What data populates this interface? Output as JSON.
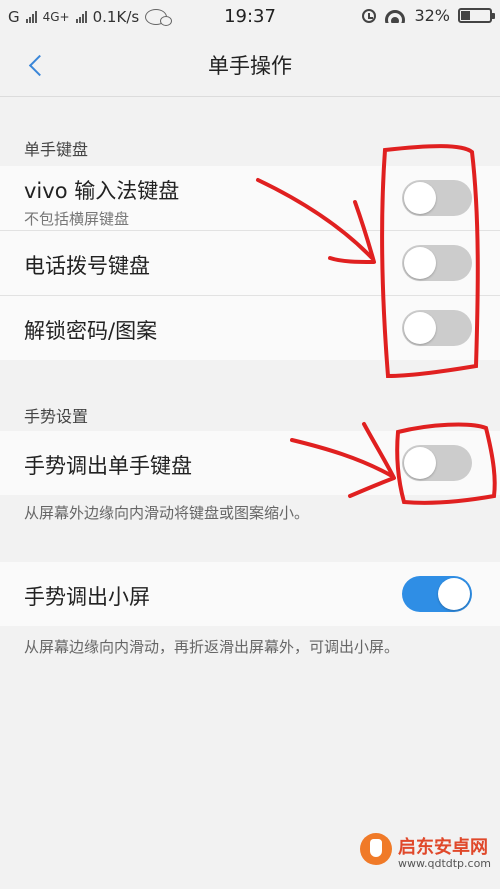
{
  "status_bar": {
    "carrier_left": "G",
    "network": "4G+",
    "speed": "0.1K/s",
    "time": "19:37",
    "battery": "32%"
  },
  "header": {
    "title": "单手操作",
    "back_icon": "chevron-left-icon"
  },
  "sections": {
    "keyboard": {
      "title": "单手键盘",
      "items": [
        {
          "label": "vivo 输入法键盘",
          "sub": "不包括横屏键盘",
          "on": false
        },
        {
          "label": "电话拨号键盘",
          "on": false
        },
        {
          "label": "解锁密码/图案",
          "on": false
        }
      ]
    },
    "gesture": {
      "title": "手势设置",
      "items": [
        {
          "label": "手势调出单手键盘",
          "on": false,
          "desc": "从屏幕外边缘向内滑动将键盘或图案缩小。"
        },
        {
          "label": "手势调出小屏",
          "on": true,
          "desc": "从屏幕边缘向内滑动，再折返滑出屏幕外，可调出小屏。"
        }
      ]
    }
  },
  "watermark": {
    "name": "启东安卓网",
    "url": "www.qdtdtp.com"
  },
  "colors": {
    "accent": "#2f8ee5",
    "toggle_off": "#cccccc",
    "annotation": "#e02020"
  }
}
